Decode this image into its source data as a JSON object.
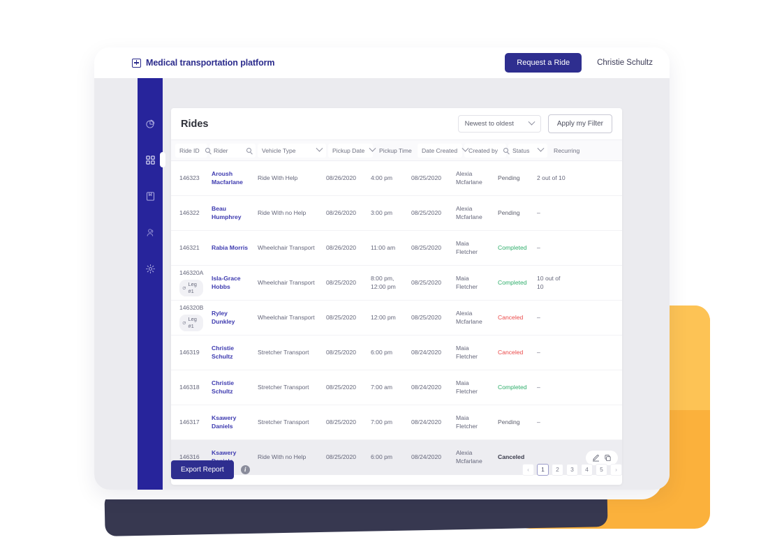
{
  "brand": {
    "logo_icon": "plus-square-icon",
    "title": "Medical transportation platform"
  },
  "appbar": {
    "request_ride_label": "Request a Ride",
    "user_name": "Christie Schultz"
  },
  "sidebar": {
    "items": [
      {
        "icon": "pie-chart-icon",
        "name": "reports",
        "active": false
      },
      {
        "icon": "grid-icon",
        "name": "rides",
        "active": true
      },
      {
        "icon": "book-icon",
        "name": "directory",
        "active": false
      },
      {
        "icon": "people-icon",
        "name": "users",
        "active": false
      },
      {
        "icon": "gear-icon",
        "name": "settings",
        "active": false
      }
    ]
  },
  "panel": {
    "title": "Rides",
    "sort": {
      "value": "Newest to oldest",
      "icon": "chevron-down-icon"
    },
    "apply_filter_label": "Apply my Filter"
  },
  "filters": [
    {
      "label": "Ride ID",
      "control": "search",
      "box": true
    },
    {
      "label": "Rider",
      "control": "search",
      "box": true,
      "wide": true
    },
    {
      "label": "Vehicle Type",
      "control": "dropdown",
      "box": true,
      "wide": true
    },
    {
      "label": "Pickup Date",
      "control": "dropdown",
      "box": true
    },
    {
      "label": "Pickup Time",
      "control": "none",
      "box": false
    },
    {
      "label": "Date Created",
      "control": "dropdown",
      "box": true
    },
    {
      "label": "Created by",
      "control": "search",
      "box": true
    },
    {
      "label": "Status",
      "control": "dropdown",
      "box": true
    },
    {
      "label": "Recurring",
      "control": "none",
      "box": false
    }
  ],
  "columns": [
    "Ride ID",
    "Rider",
    "Vehicle Type",
    "Pickup Date",
    "Pickup Time",
    "Date Created",
    "Created by",
    "Status",
    "Recurring"
  ],
  "rows": [
    {
      "ride_id": "146323",
      "leg": null,
      "rider": "Aroush Macfarlane",
      "vehicle_type": "Ride With Help",
      "pickup_date": "08/26/2020",
      "pickup_time": "4:00 pm",
      "date_created": "08/25/2020",
      "created_by": "Alexia Mcfarlane",
      "status": "Pending",
      "status_style": "pending",
      "recurring": "2 out of 10",
      "hover": false
    },
    {
      "ride_id": "146322",
      "leg": null,
      "rider": "Beau Humphrey",
      "vehicle_type": "Ride With no Help",
      "pickup_date": "08/26/2020",
      "pickup_time": "3:00 pm",
      "date_created": "08/25/2020",
      "created_by": "Alexia Mcfarlane",
      "status": "Pending",
      "status_style": "pending",
      "recurring": "–",
      "hover": false
    },
    {
      "ride_id": "146321",
      "leg": null,
      "rider": "Rabia Morris",
      "vehicle_type": "Wheelchair Transport",
      "pickup_date": "08/26/2020",
      "pickup_time": "11:00 am",
      "date_created": "08/25/2020",
      "created_by": "Maia Fletcher",
      "status": "Completed",
      "status_style": "completed",
      "recurring": "–",
      "hover": false
    },
    {
      "ride_id": "146320A",
      "leg": "Leg #1",
      "rider": "Isla-Grace Hobbs",
      "vehicle_type": "Wheelchair Transport",
      "pickup_date": "08/25/2020",
      "pickup_time": "8:00 pm, 12:00 pm",
      "date_created": "08/25/2020",
      "created_by": "Maia Fletcher",
      "status": "Completed",
      "status_style": "completed",
      "recurring": "10 out of 10",
      "hover": false
    },
    {
      "ride_id": "146320B",
      "leg": "Leg #1",
      "rider": "Ryley Dunkley",
      "vehicle_type": "Wheelchair Transport",
      "pickup_date": "08/25/2020",
      "pickup_time": "12:00 pm",
      "date_created": "08/25/2020",
      "created_by": "Alexia Mcfarlane",
      "status": "Canceled",
      "status_style": "canceled",
      "recurring": "–",
      "hover": false
    },
    {
      "ride_id": "146319",
      "leg": null,
      "rider": "Christie Schultz",
      "vehicle_type": "Stretcher Transport",
      "pickup_date": "08/25/2020",
      "pickup_time": "6:00 pm",
      "date_created": "08/24/2020",
      "created_by": "Maia Fletcher",
      "status": "Canceled",
      "status_style": "canceled",
      "recurring": "–",
      "hover": false
    },
    {
      "ride_id": "146318",
      "leg": null,
      "rider": "Christie Schultz",
      "vehicle_type": "Stretcher Transport",
      "pickup_date": "08/25/2020",
      "pickup_time": "7:00 am",
      "date_created": "08/24/2020",
      "created_by": "Maia Fletcher",
      "status": "Completed",
      "status_style": "completed",
      "recurring": "–",
      "hover": false
    },
    {
      "ride_id": "146317",
      "leg": null,
      "rider": "Ksawery Daniels",
      "vehicle_type": "Stretcher Transport",
      "pickup_date": "08/25/2020",
      "pickup_time": "7:00 pm",
      "date_created": "08/24/2020",
      "created_by": "Maia Fletcher",
      "status": "Pending",
      "status_style": "pending",
      "recurring": "–",
      "hover": false
    },
    {
      "ride_id": "146316",
      "leg": null,
      "rider": "Ksawery Daniels",
      "vehicle_type": "Ride With no Help",
      "pickup_date": "08/25/2020",
      "pickup_time": "6:00 pm",
      "date_created": "08/24/2020",
      "created_by": "Alexia Mcfarlane",
      "status": "Canceled",
      "status_style": "canceled-dark",
      "recurring": "",
      "hover": true,
      "actions": [
        "edit-icon",
        "copy-icon"
      ]
    }
  ],
  "footer": {
    "export_label": "Export Report",
    "info_icon": "info-icon",
    "pagination": {
      "prev": "‹",
      "pages": [
        "1",
        "2",
        "3",
        "4",
        "5"
      ],
      "current": "1",
      "next": "›"
    }
  },
  "colors": {
    "brand_navy": "#2B2B8C",
    "sidebar": "#27249B",
    "accent_yellow": "#FBB13C",
    "dark_navy": "#373850",
    "status_completed": "#2FAE6B",
    "status_canceled": "#EB4B4B",
    "link": "#3D3AAF"
  }
}
